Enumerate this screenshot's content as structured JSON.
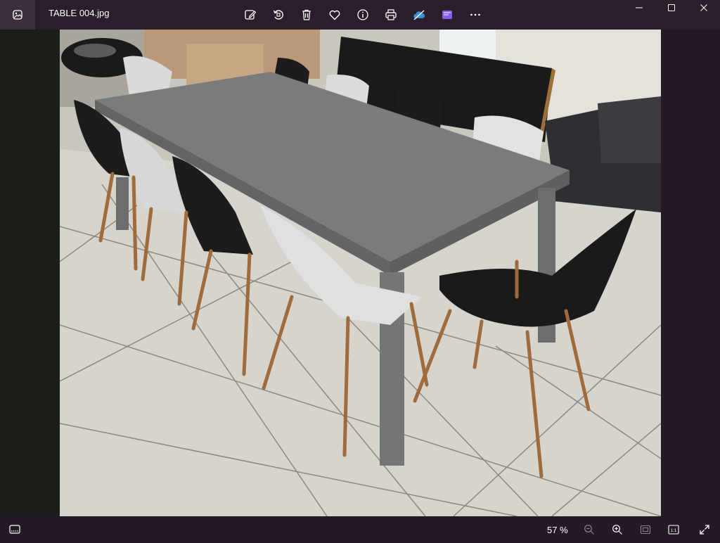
{
  "window": {
    "file_title": "TABLE 004.jpg"
  },
  "toolbar": {
    "items": [
      {
        "name": "edit-image-icon"
      },
      {
        "name": "rotate-icon"
      },
      {
        "name": "delete-icon"
      },
      {
        "name": "favorite-heart-icon"
      },
      {
        "name": "info-icon"
      },
      {
        "name": "print-icon"
      },
      {
        "name": "onedrive-cloud-icon"
      },
      {
        "name": "clipchamp-icon"
      },
      {
        "name": "more-options-icon"
      }
    ]
  },
  "statusbar": {
    "zoom_label": "57 %",
    "actual_size_label": "1:1"
  },
  "colors": {
    "accent_purple": "#8a5cf6",
    "cloud_blue": "#3b8fd6"
  }
}
